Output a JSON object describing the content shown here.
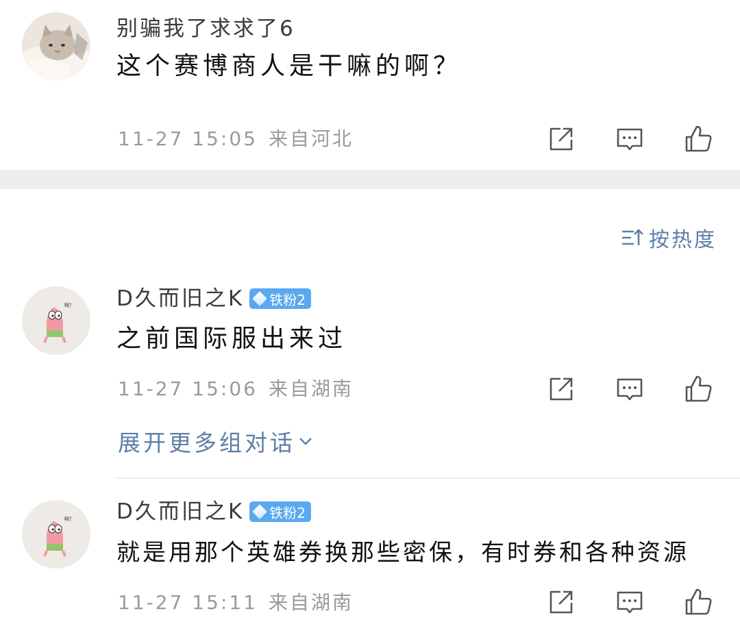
{
  "comments": [
    {
      "username": "别骗我了求求了6",
      "content": "这个赛博商人是干嘛的啊？",
      "time": "11-27 15:05",
      "location": "来自河北"
    },
    {
      "username": "D久而旧之K",
      "badge": "铁粉2",
      "content": "之前国际服出来过",
      "time": "11-27 15:06",
      "location": "来自湖南"
    },
    {
      "username": "D久而旧之K",
      "badge": "铁粉2",
      "content": "就是用那个英雄券换那些密保，有时券和各种资源",
      "time": "11-27 15:11",
      "location": "来自湖南"
    }
  ],
  "sort_label": "按热度",
  "expand_label": "展开更多组对话",
  "avatar_speech": "啊？",
  "colors": {
    "link": "#5c7ea8",
    "badge": "#5aa8f0",
    "meta": "#9a9a9a",
    "divider": "#eeeeee"
  },
  "icons": [
    "share-icon",
    "comment-icon",
    "like-icon",
    "sort-icon",
    "chevron-down-icon",
    "diamond-icon"
  ]
}
